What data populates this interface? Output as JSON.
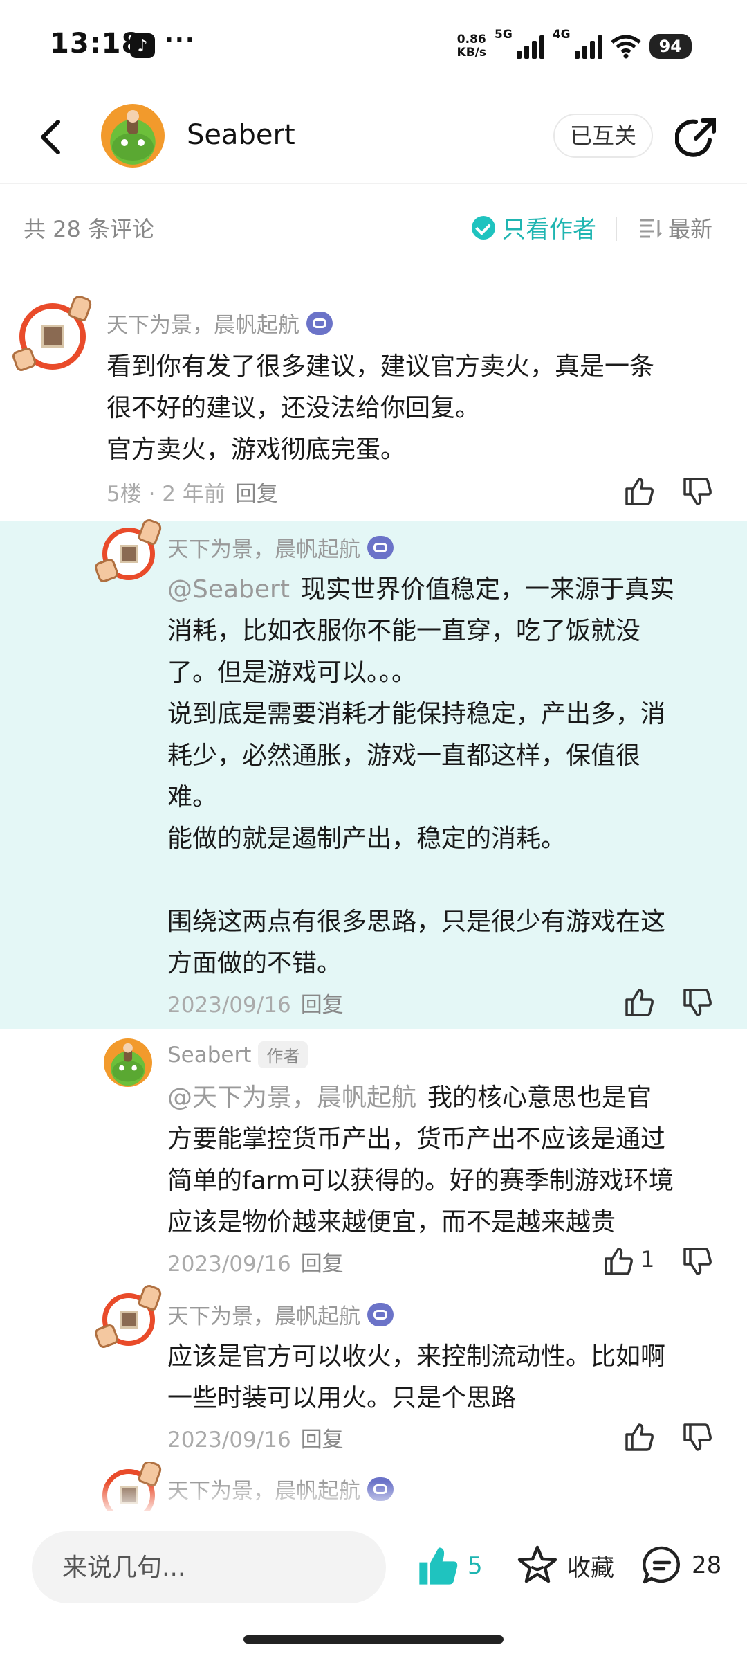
{
  "status_bar": {
    "time": "13:18",
    "more": "···",
    "speed_top": "0.86",
    "speed_unit": "KB/s",
    "net1": "5G",
    "net2": "4G",
    "battery": "94",
    "icons": [
      "tiktok-icon",
      "signal-icon",
      "wifi-icon",
      "battery-icon"
    ]
  },
  "header": {
    "back_icon": "back-arrow-icon",
    "author_name": "Seabert",
    "follow_label": "已互关",
    "share_icon": "share-icon"
  },
  "filter": {
    "count_text": "共 28 条评论",
    "author_only_label": "只看作者",
    "sort_label": "最新"
  },
  "comments": [
    {
      "author": "天下为景，晨帆起航",
      "mention": "",
      "text": "看到你有发了很多建议，建议官方卖火，真是一条\n很不好的建议，还没法给你回复。\n官方卖火，游戏彻底完蛋。",
      "meta": "5楼 · 2 年前",
      "reply_label": "回复",
      "likes": ""
    },
    {
      "author": "天下为景，晨帆起航",
      "mention": "@Seabert",
      "text": "现实世界价值稳定，一来源于真实\n消耗，比如衣服你不能一直穿，吃了饭就没\n了。但是游戏可以。。。\n说到底是需要消耗才能保持稳定，产出多，消\n耗少，必然通胀，游戏一直都这样，保值很\n难。\n能做的就是遏制产出，稳定的消耗。\n\n围绕这两点有很多思路，只是很少有游戏在这\n方面做的不错。",
      "meta": "2023/09/16",
      "reply_label": "回复",
      "likes": ""
    },
    {
      "author": "Seabert",
      "author_tag": "作者",
      "mention": "@天下为景，晨帆起航",
      "text": "我的核心意思也是官\n方要能掌控货币产出，货币产出不应该是通过\n简单的farm可以获得的。好的赛季制游戏环境\n应该是物价越来越便宜，而不是越来越贵",
      "meta": "2023/09/16",
      "reply_label": "回复",
      "likes": "1"
    },
    {
      "author": "天下为景，晨帆起航",
      "mention": "",
      "text": "应该是官方可以收火，来控制流动性。比如啊\n一些时装可以用火。只是个思路",
      "meta": "2023/09/16",
      "reply_label": "回复",
      "likes": ""
    },
    {
      "author": "天下为景，晨帆起航",
      "mention": "",
      "text": "",
      "meta": "",
      "reply_label": "",
      "likes": ""
    }
  ],
  "bottom_bar": {
    "input_placeholder": "来说几句...",
    "like_count": "5",
    "favorite_label": "收藏",
    "comment_count": "28"
  },
  "colors": {
    "accent": "#1fb5b1",
    "highlight_bg": "#e4f7f6",
    "meta_gray": "#aaaaaa",
    "ring_red": "#e94b2a"
  }
}
